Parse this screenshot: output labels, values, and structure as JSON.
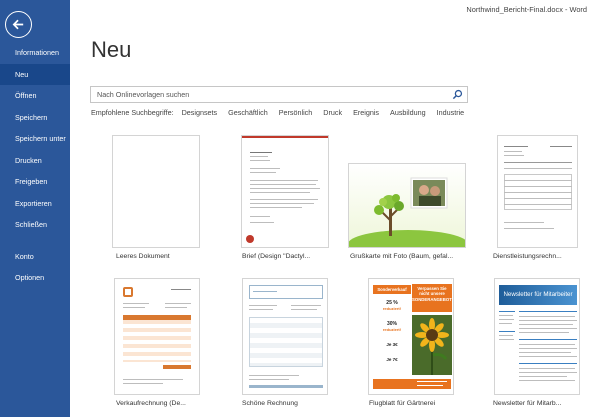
{
  "window": {
    "title": "Northwind_Bericht-Final.docx - Word"
  },
  "sidebar": {
    "back_icon": "back-arrow-icon",
    "items": [
      {
        "label": "Informationen"
      },
      {
        "label": "Neu",
        "active": true
      },
      {
        "label": "Öffnen"
      },
      {
        "label": "Speichern"
      },
      {
        "label": "Speichern unter"
      },
      {
        "label": "Drucken"
      },
      {
        "label": "Freigeben"
      },
      {
        "label": "Exportieren"
      },
      {
        "label": "Schließen"
      },
      {
        "label": "Konto"
      },
      {
        "label": "Optionen"
      }
    ]
  },
  "main": {
    "title": "Neu",
    "search": {
      "placeholder": "Nach Onlinevorlagen suchen",
      "value": ""
    },
    "suggestions": {
      "label": "Empfohlene Suchbegriffe:",
      "terms": [
        "Designsets",
        "Geschäftlich",
        "Persönlich",
        "Druck",
        "Ereignis",
        "Ausbildung",
        "Industrie"
      ]
    },
    "templates": [
      {
        "label": "Leeres Dokument"
      },
      {
        "label": "Brief (Design \"Dactyl..."
      },
      {
        "label": "Grußkarte mit Foto (Baum, gefal..."
      },
      {
        "label": "Dienstleistungsrechn..."
      },
      {
        "label": "Verkaufrechnung (De..."
      },
      {
        "label": "Schöne Rechnung"
      },
      {
        "label": "Flugblatt für Gärtnerei"
      },
      {
        "label": "Newsletter für Mitarb..."
      }
    ],
    "flyer": {
      "sale": "Sonderverkauf",
      "headline": "Verpassen Sie nicht unsere SONDERANGEBOTE!",
      "offer1": "25 %",
      "offer1_sub": "reduziert!",
      "offer2": "30%",
      "offer2_sub": "reduziert!",
      "price1": "Je 3€",
      "price2": "Je 7€"
    },
    "newsletter": {
      "masthead": "Newsletter für Mitarbeiter"
    }
  },
  "colors": {
    "sidebar": "#2b579a",
    "sidebar_active": "#19478a",
    "flyer_orange": "#e8731f",
    "newsletter_blue": "#3a7fc1",
    "invoice_orange": "#d9782f"
  }
}
